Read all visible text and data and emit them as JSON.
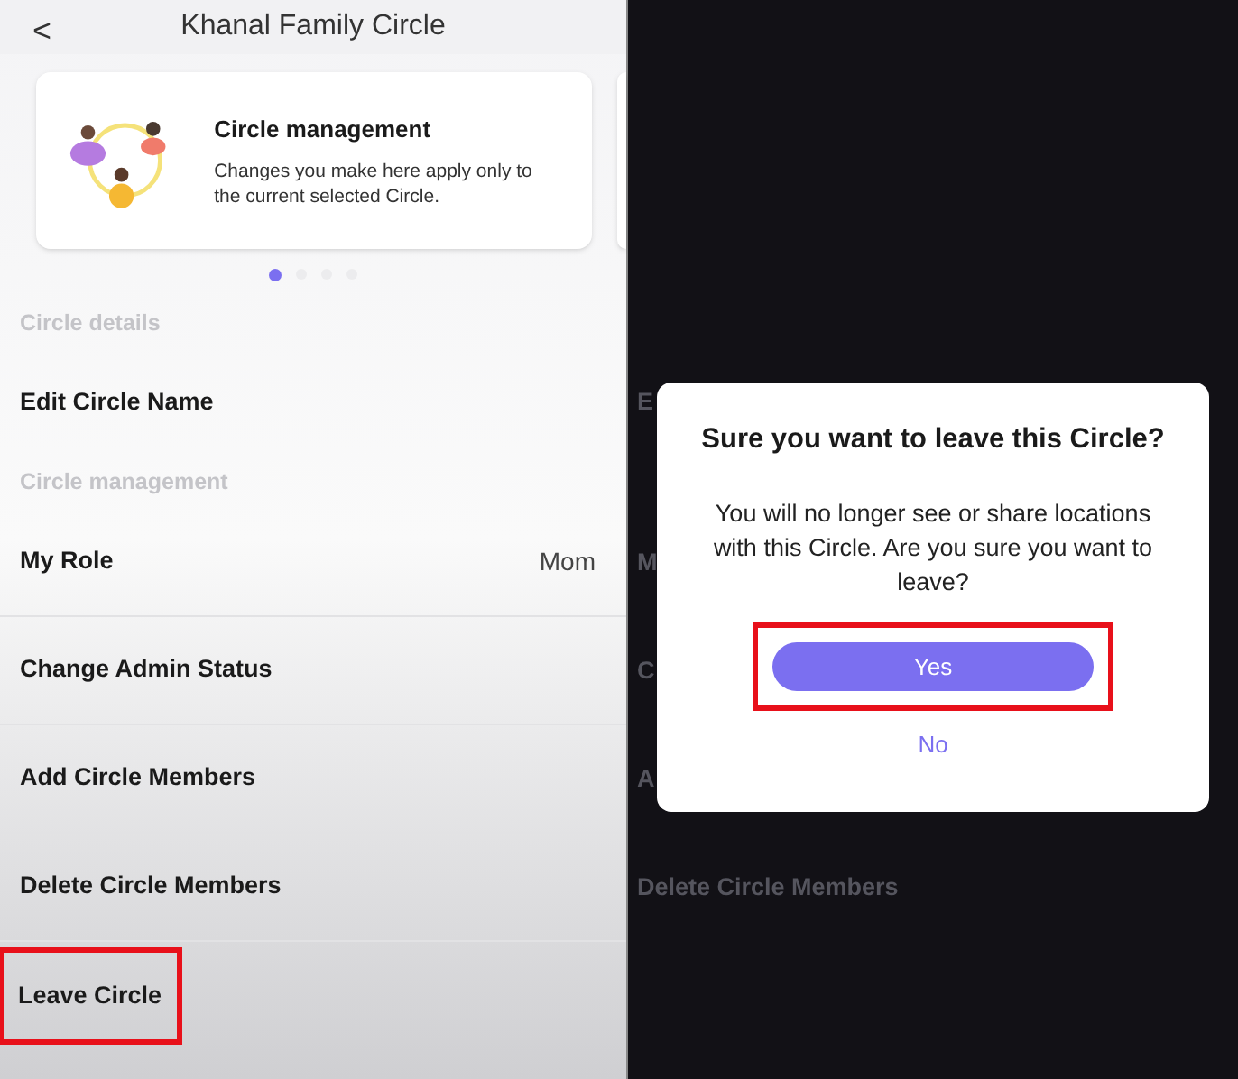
{
  "header": {
    "back": "<",
    "title": "Khanal Family  Circle"
  },
  "card": {
    "title": "Circle management",
    "text": "Changes you make here apply only to the current selected Circle."
  },
  "pager": [
    {
      "selected": true
    },
    {
      "selected": false
    },
    {
      "selected": false
    },
    {
      "selected": false
    }
  ],
  "sections": [
    {
      "label": "Circle details",
      "items": [
        {
          "label": "Edit Circle Name",
          "highlighted": false
        }
      ]
    },
    {
      "label": "Circle management",
      "items": [
        {
          "label": "My Role",
          "value": "Mom",
          "highlighted": false
        },
        {
          "label": "Change Admin Status",
          "highlighted": false
        },
        {
          "label": "Add Circle Members",
          "highlighted": false
        },
        {
          "label": "Delete Circle Members",
          "highlighted": false
        },
        {
          "label": "Leave Circle",
          "highlighted": true
        }
      ]
    }
  ],
  "background_rows": [
    "E",
    "M",
    "C",
    "A",
    "Delete Circle Members"
  ],
  "dialog": {
    "title": "Sure you want to leave this Circle?",
    "text": "You will no longer see or share locations with this Circle. Are you sure you want to leave?",
    "confirm": {
      "label": "Yes",
      "highlighted": true
    },
    "cancel": "No"
  }
}
